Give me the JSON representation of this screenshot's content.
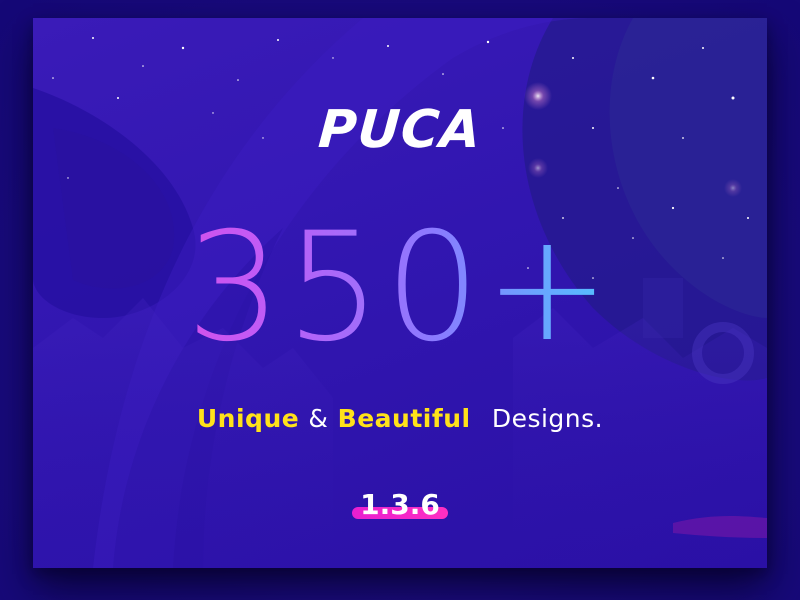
{
  "brand": {
    "logo_text": "PUCA"
  },
  "hero": {
    "count": "350+",
    "tagline": {
      "word1": "Unique",
      "amp": "&",
      "word2": "Beautiful",
      "word3": "Designs."
    },
    "version": "1.3.6"
  },
  "colors": {
    "background": "#1c0c85",
    "card": "#3116b0",
    "gradient_start": "#f03fd6",
    "gradient_end": "#3fe0ff",
    "accent_yellow": "#ffe21a",
    "version_highlight": "#e81fd0"
  }
}
